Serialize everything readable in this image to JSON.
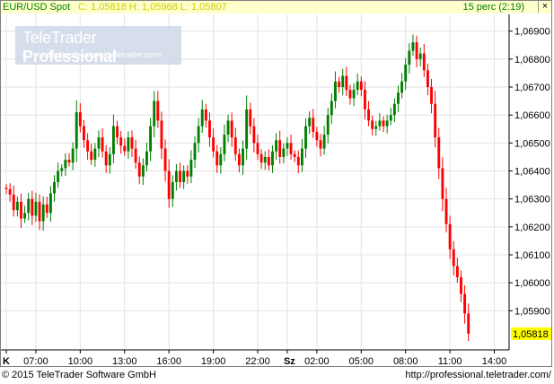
{
  "header": {
    "symbol": "EUR/USD Spot",
    "quote": "C: 1,05818 H: 1,05968 L: 1,05807",
    "timeframe": "15 perc (2:19)",
    "close_glyph": "×"
  },
  "watermark": {
    "brand_light": "TeleTrader",
    "brand_bold": "Professional",
    "url": "http://professional.teletrader.com/"
  },
  "footer": {
    "copyright": "© 2015 TeleTrader Software GmbH",
    "url": "http://professional.teletrader.com/"
  },
  "colors": {
    "up": "#008000",
    "down": "#ff0000",
    "grid": "#e3e3e3",
    "last_price_bg": "#ffff00"
  },
  "chart_data": {
    "type": "candlestick",
    "interval": "15 perc",
    "y_ticks": [
      "1,05900",
      "1,06000",
      "1,06100",
      "1,06200",
      "1,06300",
      "1,06400",
      "1,06500",
      "1,06600",
      "1,06700",
      "1,06800",
      "1,06900"
    ],
    "ylim": [
      1.0576,
      1.0696
    ],
    "last_price": "1,05818",
    "x_ticks": [
      {
        "label": "K",
        "idx": 0,
        "bold": true
      },
      {
        "label": "07:00",
        "idx": 8
      },
      {
        "label": "10:00",
        "idx": 20
      },
      {
        "label": "13:00",
        "idx": 32
      },
      {
        "label": "16:00",
        "idx": 44
      },
      {
        "label": "19:00",
        "idx": 56
      },
      {
        "label": "22:00",
        "idx": 68
      },
      {
        "label": "Sz",
        "idx": 76,
        "bold": true
      },
      {
        "label": "02:00",
        "idx": 84
      },
      {
        "label": "05:00",
        "idx": 96
      },
      {
        "label": "08:00",
        "idx": 108
      },
      {
        "label": "11:00",
        "idx": 120
      },
      {
        "label": "14:00",
        "idx": 132
      }
    ],
    "n_slots": 136,
    "closes": [
      1.06335,
      1.06315,
      1.0626,
      1.0629,
      1.0623,
      1.0625,
      1.063,
      1.0624,
      1.0629,
      1.0622,
      1.0628,
      1.0625,
      1.0632,
      1.0636,
      1.064,
      1.0641,
      1.0644,
      1.0643,
      1.0648,
      1.0661,
      1.0656,
      1.0651,
      1.0647,
      1.0644,
      1.0648,
      1.0652,
      1.0647,
      1.0642,
      1.0646,
      1.0656,
      1.0652,
      1.0649,
      1.0647,
      1.0652,
      1.0648,
      1.0643,
      1.0638,
      1.0642,
      1.0647,
      1.0656,
      1.0665,
      1.0658,
      1.0648,
      1.064,
      1.063,
      1.0636,
      1.064,
      1.0636,
      1.064,
      1.0638,
      1.0644,
      1.065,
      1.0656,
      1.0662,
      1.0658,
      1.0652,
      1.0647,
      1.0642,
      1.0646,
      1.0653,
      1.0658,
      1.0652,
      1.0646,
      1.0642,
      1.0648,
      1.0662,
      1.0656,
      1.065,
      1.0646,
      1.0643,
      1.0645,
      1.0642,
      1.0647,
      1.0651,
      1.0645,
      1.0648,
      1.065,
      1.0646,
      1.0645,
      1.0642,
      1.0648,
      1.0656,
      1.0659,
      1.0654,
      1.0651,
      1.0648,
      1.0653,
      1.066,
      1.0665,
      1.0672,
      1.067,
      1.0674,
      1.0669,
      1.0666,
      1.0669,
      1.0672,
      1.0669,
      1.0662,
      1.0658,
      1.0655,
      1.0656,
      1.0658,
      1.0656,
      1.0658,
      1.066,
      1.0664,
      1.0668,
      1.0672,
      1.0678,
      1.0683,
      1.0686,
      1.068,
      1.0682,
      1.0676,
      1.067,
      1.0664,
      1.0652,
      1.0641,
      1.063,
      1.0621,
      1.0612,
      1.0606,
      1.0602,
      1.0596,
      1.0589,
      1.05818
    ],
    "open_first": 1.0634
  }
}
